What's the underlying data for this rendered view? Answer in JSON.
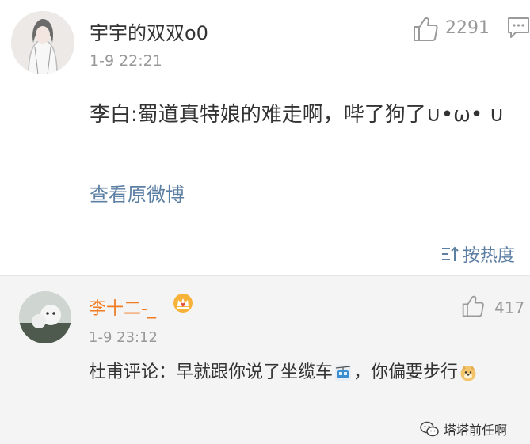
{
  "post": {
    "username": "宇宇的双双o0",
    "time": "1-9 22:21",
    "like_count": "2291",
    "content": "李白:蜀道真特娘的难走啊，哔了狗了∪•ω• ∪",
    "view_original": "查看原微博",
    "sort_label": "按热度"
  },
  "reply": {
    "username": "李十二-_",
    "time": "1-9 23:12",
    "like_count": "417",
    "content_before": "杜甫评论：早就跟你说了坐缆车",
    "content_middle": "，你偏要步行",
    "emoji_cablecar": "cable-car-emoji",
    "emoji_dog": "doge-emoji"
  },
  "watermark": {
    "text": "塔塔前任啊"
  },
  "colors": {
    "link_blue": "#5b7ea3",
    "username_orange": "#f07d23",
    "muted_gray": "#999999",
    "reply_bg": "#f4f4f4"
  }
}
